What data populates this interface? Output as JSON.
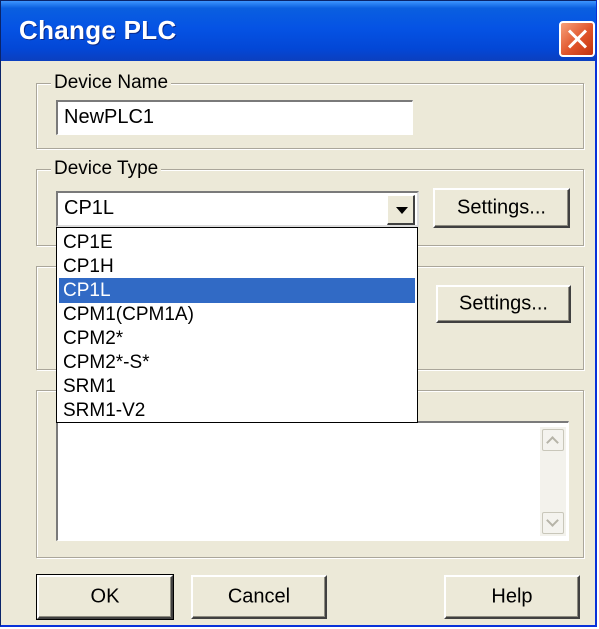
{
  "window": {
    "title": "Change PLC"
  },
  "device_name": {
    "legend": "Device Name",
    "value": "NewPLC1"
  },
  "device_type": {
    "legend": "Device Type",
    "selected": "CP1L",
    "settings_label": "Settings...",
    "options": [
      "CP1E",
      "CP1H",
      "CP1L",
      "CPM1(CPM1A)",
      "CPM2*",
      "CPM2*-S*",
      "SRM1",
      "SRM1-V2"
    ],
    "highlighted": "CP1L"
  },
  "network_type": {
    "legend_visible_char": "",
    "settings_label": "Settings..."
  },
  "comment": {
    "legend_visible_char": ""
  },
  "buttons": {
    "ok": "OK",
    "cancel": "Cancel",
    "help": "Help"
  },
  "colors": {
    "title_bar": "#0553e4",
    "selection": "#316ac5",
    "dialog_bg": "#ece9d8",
    "close_button": "#e0542a"
  }
}
